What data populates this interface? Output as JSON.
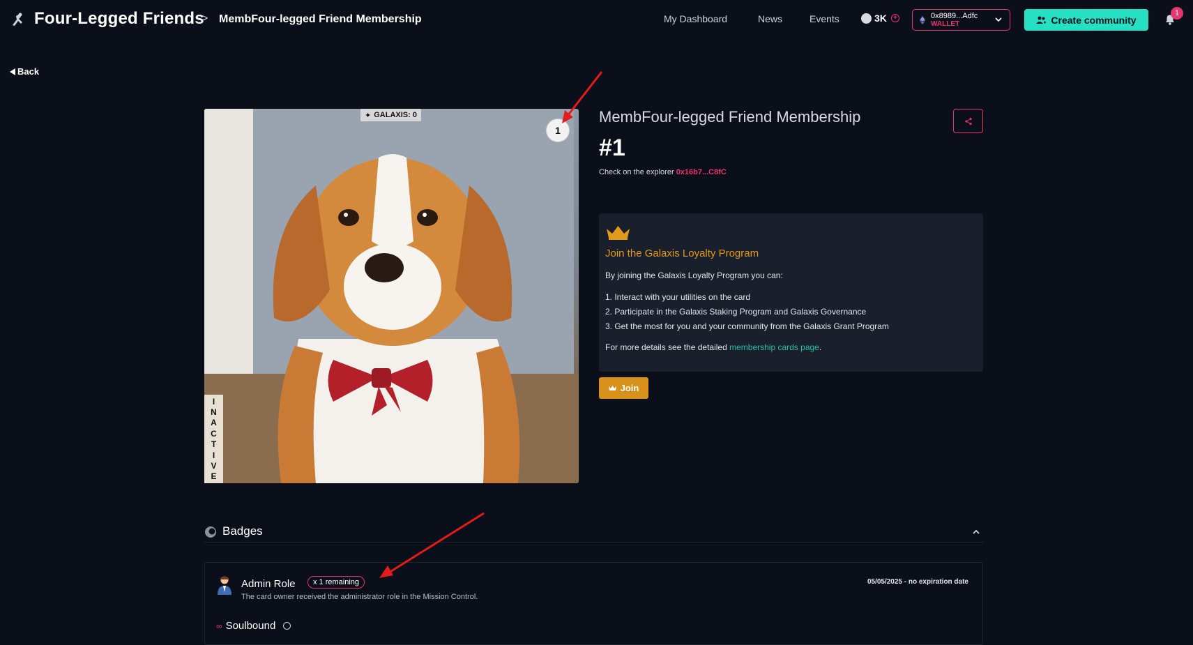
{
  "header": {
    "brand_title": "Four-Legged Friends",
    "breadcrumb_separator": ">",
    "breadcrumb_current": "MembFour-legged Friend Membership",
    "nav": [
      "My Dashboard",
      "News",
      "Events"
    ],
    "points": "3K",
    "wallet_address": "0x8989...Adfc",
    "wallet_label": "WALLET",
    "create_label": "Create community",
    "notification_count": "1"
  },
  "back_label": "Back",
  "card": {
    "galaxis_chip": "GALAXIS: 0",
    "number_chip": "1",
    "status_letters": [
      "I",
      "N",
      "A",
      "C",
      "T",
      "I",
      "V",
      "E"
    ],
    "title": "MembFour-legged Friend Membership",
    "number": "#1",
    "explorer_text": "Check on the explorer",
    "explorer_address": "0x16b7...C8fC"
  },
  "loyalty": {
    "title": "Join the Galaxis Loyalty Program",
    "intro": "By joining the Galaxis Loyalty Program you can:",
    "items": [
      "1. Interact with your utilities on the card",
      "2. Participate in the Galaxis Staking Program and Galaxis Governance",
      "3. Get the most for you and your community from the Galaxis Grant Program"
    ],
    "more_prefix": "For more details see the detailed",
    "more_link": "membership cards page",
    "more_suffix": ".",
    "join_label": "Join"
  },
  "badges": {
    "title": "Badges",
    "items": [
      {
        "role": "Admin Role",
        "remaining": "x 1 remaining",
        "description": "The card owner received the administrator role in the Mission Control.",
        "date": "05/05/2025 - no expiration date",
        "soulbound_label": "Soulbound"
      }
    ]
  },
  "colors": {
    "background": "#0b0f19",
    "accent_pink": "#e8346f",
    "accent_teal": "#25e0c2",
    "accent_gold": "#e29a1b"
  }
}
